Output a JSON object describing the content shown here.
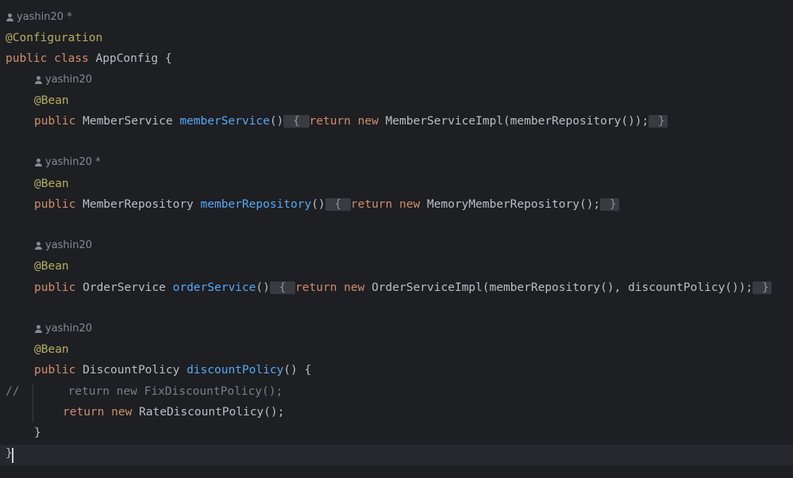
{
  "editor": {
    "lines": [
      {
        "type": "hint",
        "author": "yashin20 *"
      },
      {
        "type": "code",
        "parts": [
          {
            "cls": "anno",
            "text": "@Configuration"
          }
        ]
      },
      {
        "type": "code",
        "parts": [
          {
            "cls": "kw",
            "text": "public class "
          },
          {
            "cls": "plain",
            "text": "AppConfig "
          },
          {
            "cls": "plain",
            "text": "{"
          }
        ]
      },
      {
        "type": "hint",
        "author": "yashin20",
        "indent": 1
      },
      {
        "type": "code",
        "indent": 1,
        "parts": [
          {
            "cls": "anno",
            "text": "@Bean"
          }
        ]
      },
      {
        "type": "code",
        "indent": 1,
        "parts": [
          {
            "cls": "kw",
            "text": "public "
          },
          {
            "cls": "plain",
            "text": "MemberService "
          },
          {
            "cls": "fn",
            "text": "memberService"
          },
          {
            "cls": "plain",
            "text": "()"
          },
          {
            "cls": "fold",
            "text": " { "
          },
          {
            "cls": "kw",
            "text": "return new "
          },
          {
            "cls": "plain",
            "text": "MemberServiceImpl(memberRepository());"
          },
          {
            "cls": "fold",
            "text": " }"
          }
        ]
      },
      {
        "type": "blank"
      },
      {
        "type": "hint",
        "author": "yashin20 *",
        "indent": 1
      },
      {
        "type": "code",
        "indent": 1,
        "parts": [
          {
            "cls": "anno",
            "text": "@Bean"
          }
        ]
      },
      {
        "type": "code",
        "indent": 1,
        "parts": [
          {
            "cls": "kw",
            "text": "public "
          },
          {
            "cls": "plain",
            "text": "MemberRepository "
          },
          {
            "cls": "fn",
            "text": "memberRepository"
          },
          {
            "cls": "plain",
            "text": "()"
          },
          {
            "cls": "fold",
            "text": " { "
          },
          {
            "cls": "kw",
            "text": "return new "
          },
          {
            "cls": "plain",
            "text": "MemoryMemberRepository();"
          },
          {
            "cls": "fold",
            "text": " }"
          }
        ]
      },
      {
        "type": "blank"
      },
      {
        "type": "hint",
        "author": "yashin20",
        "indent": 1
      },
      {
        "type": "code",
        "indent": 1,
        "parts": [
          {
            "cls": "anno",
            "text": "@Bean"
          }
        ]
      },
      {
        "type": "code",
        "indent": 1,
        "parts": [
          {
            "cls": "kw",
            "text": "public "
          },
          {
            "cls": "plain",
            "text": "OrderService "
          },
          {
            "cls": "fn",
            "text": "orderService"
          },
          {
            "cls": "plain",
            "text": "()"
          },
          {
            "cls": "fold",
            "text": " { "
          },
          {
            "cls": "kw",
            "text": "return new "
          },
          {
            "cls": "plain",
            "text": "OrderServiceImpl(memberRepository(), discountPolicy());"
          },
          {
            "cls": "fold",
            "text": " }"
          }
        ]
      },
      {
        "type": "blank"
      },
      {
        "type": "hint",
        "author": "yashin20",
        "indent": 1
      },
      {
        "type": "code",
        "indent": 1,
        "parts": [
          {
            "cls": "anno",
            "text": "@Bean"
          }
        ]
      },
      {
        "type": "code",
        "indent": 1,
        "parts": [
          {
            "cls": "kw",
            "text": "public "
          },
          {
            "cls": "plain",
            "text": "DiscountPolicy "
          },
          {
            "cls": "fn",
            "text": "discountPolicy"
          },
          {
            "cls": "plain",
            "text": "() {"
          }
        ]
      },
      {
        "type": "code",
        "parts": [
          {
            "cls": "cmt",
            "text": "//       return new FixDiscountPolicy();"
          }
        ]
      },
      {
        "type": "code",
        "indent": 2,
        "parts": [
          {
            "cls": "kw",
            "text": "return new "
          },
          {
            "cls": "plain",
            "text": "RateDiscountPolicy();"
          }
        ]
      },
      {
        "type": "code",
        "indent": 1,
        "parts": [
          {
            "cls": "plain",
            "text": "}"
          }
        ]
      },
      {
        "type": "code",
        "parts": [
          {
            "cls": "plain",
            "text": "}"
          }
        ]
      }
    ]
  }
}
